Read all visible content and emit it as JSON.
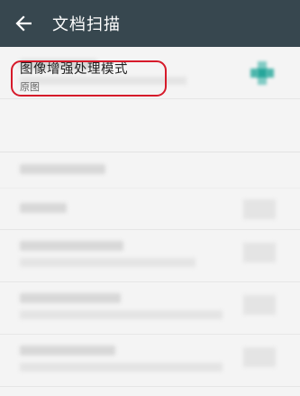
{
  "appbar": {
    "back_icon": "arrow-left-icon",
    "title": "文档扫描"
  },
  "settings": {
    "enhance_mode": {
      "title": "图像增强处理模式",
      "value": "原图"
    }
  },
  "colors": {
    "appbar_bg": "#37474f",
    "highlight_border": "#d61a2a",
    "accent_teal": "#26a69a"
  }
}
